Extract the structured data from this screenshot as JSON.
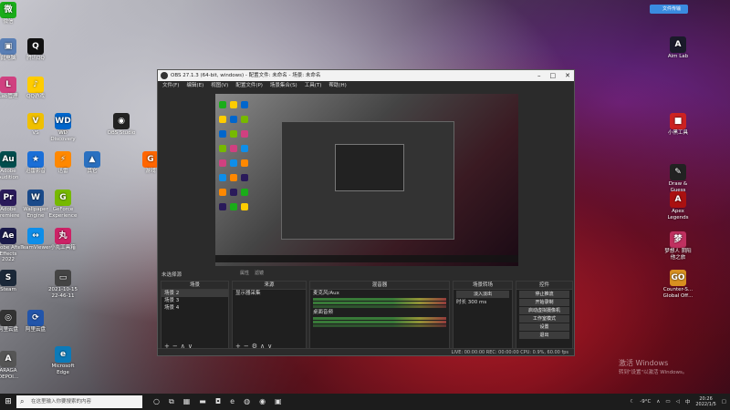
{
  "desktop": {
    "left_icons": [
      {
        "name": "wechat",
        "label": "微信",
        "color": "#1aad19",
        "glyph": "微"
      },
      {
        "name": "app1",
        "label": "此电脑",
        "color": "#5a7fb5",
        "glyph": "▣"
      },
      {
        "name": "qq",
        "label": "腾讯QQ",
        "color": "#111111",
        "glyph": "Q"
      },
      {
        "name": "app2",
        "label": "Lab管理",
        "color": "#d04080",
        "glyph": "L"
      },
      {
        "name": "qq-music",
        "label": "QQ游戏",
        "color": "#ffcc00",
        "glyph": "♪"
      },
      {
        "name": "app3",
        "label": "WP",
        "color": "#e8a030",
        "glyph": "W"
      },
      {
        "name": "vshare",
        "label": "VS",
        "color": "#f0c000",
        "glyph": "V"
      },
      {
        "name": "wd",
        "label": "WD Discovery",
        "color": "#0066cc",
        "glyph": "WD"
      },
      {
        "name": "obs",
        "label": "OBS Studio",
        "color": "#222222",
        "glyph": "◉"
      },
      {
        "name": "adobe-au",
        "label": "Adobe Audition",
        "color": "#004d4d",
        "glyph": "Au"
      },
      {
        "name": "app4",
        "label": "迅雷影音",
        "color": "#1a6fd8",
        "glyph": "★"
      },
      {
        "name": "app5",
        "label": "迅雷",
        "color": "#ff8800",
        "glyph": "⚡"
      },
      {
        "name": "app6",
        "label": "其它",
        "color": "#2a70c0",
        "glyph": "▲"
      },
      {
        "name": "app7",
        "label": "游戏",
        "color": "#ff6600",
        "glyph": "G"
      },
      {
        "name": "adobe-pr",
        "label": "Adobe Premiere",
        "color": "#2a1a5a",
        "glyph": "Pr"
      },
      {
        "name": "wallpaper",
        "label": "Wallpaper Engine",
        "color": "#1a4a8a",
        "glyph": "W"
      },
      {
        "name": "geforce",
        "label": "GeForce Experience",
        "color": "#76b900",
        "glyph": "G"
      },
      {
        "name": "adobe-ae",
        "label": "Adobe After Effects 2022",
        "color": "#1a1a4a",
        "glyph": "Ae"
      },
      {
        "name": "teamviewer",
        "label": "TeamViewer",
        "color": "#0e8ee9",
        "glyph": "↔"
      },
      {
        "name": "app8",
        "label": "小丸工具箱",
        "color": "#cc2266",
        "glyph": "丸"
      },
      {
        "name": "steam",
        "label": "Steam",
        "color": "#1b2838",
        "glyph": "S"
      },
      {
        "name": "screenshot",
        "label": "2021-10-15 22-46-11",
        "color": "#444444",
        "glyph": "▭"
      },
      {
        "name": "app9",
        "label": "阿里云盘",
        "color": "#333333",
        "glyph": "◎"
      },
      {
        "name": "app10",
        "label": "阿里云盘",
        "color": "#2255aa",
        "glyph": "⟳"
      },
      {
        "name": "edge",
        "label": "Microsoft Edge",
        "color": "#0c7ab8",
        "glyph": "e"
      },
      {
        "name": "app11",
        "label": "ARAGA DEPOI...",
        "color": "#555555",
        "glyph": "A"
      }
    ],
    "right_icons": [
      {
        "name": "aimlab",
        "label": "Aim Lab",
        "color": "#1a1a2a",
        "glyph": "A"
      },
      {
        "name": "app12",
        "label": "小黑工具",
        "color": "#cc2222",
        "glyph": "■"
      },
      {
        "name": "draw-guess",
        "label": "Draw & Guess",
        "color": "#222222",
        "glyph": "✎"
      },
      {
        "name": "apex",
        "label": "Apex Legends",
        "color": "#aa1111",
        "glyph": "A"
      },
      {
        "name": "app13",
        "label": "梦想人 阴阳 他之旅",
        "color": "#c03060",
        "glyph": "梦"
      },
      {
        "name": "csgo",
        "label": "Counter-S... Global Off...",
        "color": "#d89020",
        "glyph": "GO"
      }
    ],
    "cloud_button": "文件传输",
    "watermark_title": "激活 Windows",
    "watermark_sub": "转到\"设置\"以激活 Windows。"
  },
  "obs": {
    "title": "OBS 27.1.3 (64-bit, windows) - 配置文件: 未命名 - 场景: 未命名",
    "menu": [
      "文件(F)",
      "编辑(E)",
      "视图(V)",
      "配置文件(P)",
      "场景集合(S)",
      "工具(T)",
      "帮助(H)"
    ],
    "scene_label": "未选择源",
    "filter_btns": [
      "属性",
      "滤镜"
    ],
    "scenes": {
      "title": "场景",
      "items": [
        "场景 2",
        "场景 3",
        "场景 4"
      ],
      "selected": 0
    },
    "sources": {
      "title": "来源",
      "items": [
        "显示器采集"
      ]
    },
    "mixer": {
      "title": "混音器",
      "channels": [
        {
          "name": "桌面音频",
          "db": "0.0 dB"
        },
        {
          "name": "麦克风/Aux",
          "db": "0.0 dB"
        }
      ]
    },
    "transitions": {
      "title": "场景转场",
      "type": "淡入淡出",
      "duration_label": "时长",
      "duration": "300 ms"
    },
    "controls": {
      "title": "控件",
      "buttons": [
        "停止推流",
        "开始录制",
        "启动虚拟摄像机",
        "工作室模式",
        "设置",
        "退出"
      ]
    },
    "status": "LIVE: 00:00:00   REC: 00:00:00   CPU: 0.9%, 60.00 fps"
  },
  "taskbar": {
    "search_placeholder": "在这里输入你要搜索的内容",
    "weather": "-9°C",
    "ime": "中",
    "time": "20:26",
    "date": "2022/1/5"
  }
}
